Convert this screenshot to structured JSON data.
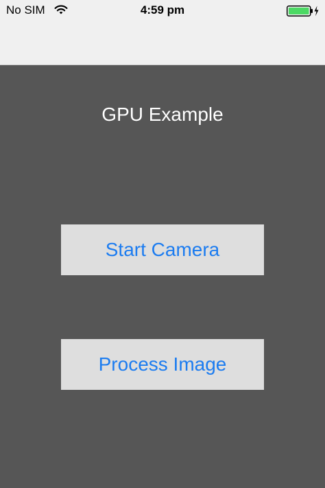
{
  "status_bar": {
    "carrier": "No SIM",
    "time": "4:59 pm",
    "wifi_icon": "wifi-icon",
    "battery_icon": "battery-charging-icon",
    "battery_color": "#4cd964"
  },
  "main": {
    "title": "GPU Example",
    "start_camera_label": "Start Camera",
    "process_image_label": "Process Image",
    "button_text_color": "#1c7cf0",
    "button_background": "#dedede",
    "background": "#565656"
  }
}
